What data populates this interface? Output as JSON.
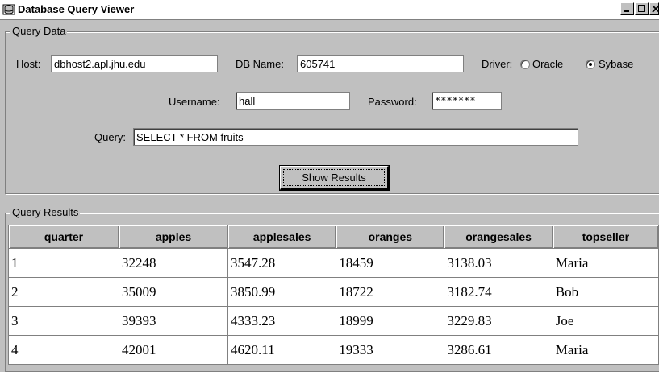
{
  "window": {
    "title": "Database Query Viewer",
    "controls": {
      "minimize": "_",
      "maximize": "□",
      "close": "×"
    },
    "icon": "database-window-icon"
  },
  "query_data": {
    "legend": "Query Data",
    "host_label": "Host:",
    "host_value": "dbhost2.apl.jhu.edu",
    "dbname_label": "DB Name:",
    "dbname_value": "605741",
    "driver_label": "Driver:",
    "driver_options": [
      "Oracle",
      "Sybase"
    ],
    "driver_selected": "Sybase",
    "username_label": "Username:",
    "username_value": "hall",
    "password_label": "Password:",
    "password_value": "*******",
    "query_label": "Query:",
    "query_value": "SELECT * FROM fruits",
    "show_results_label": "Show Results"
  },
  "query_results": {
    "legend": "Query Results",
    "columns": [
      "quarter",
      "apples",
      "applesales",
      "oranges",
      "orangesales",
      "topseller"
    ],
    "rows": [
      [
        "1",
        "32248",
        "3547.28",
        "18459",
        "3138.03",
        "Maria"
      ],
      [
        "2",
        "35009",
        "3850.99",
        "18722",
        "3182.74",
        "Bob"
      ],
      [
        "3",
        "39393",
        "4333.23",
        "18999",
        "3229.83",
        "Joe"
      ],
      [
        "4",
        "42001",
        "4620.11",
        "19333",
        "3286.61",
        "Maria"
      ]
    ]
  }
}
